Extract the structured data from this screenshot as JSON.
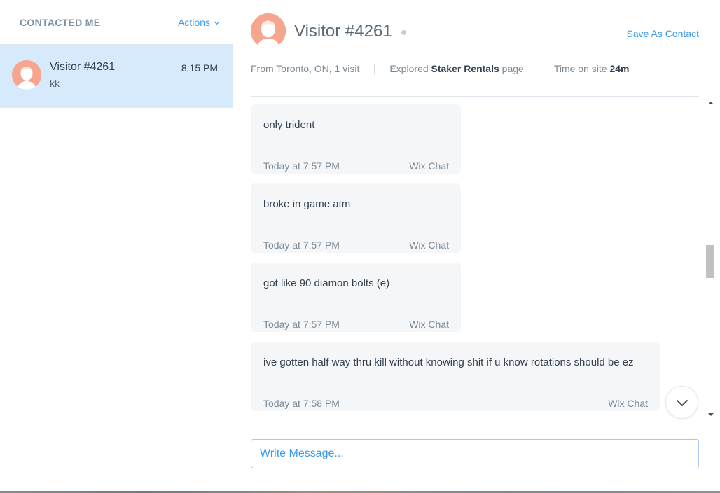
{
  "sidebar": {
    "title": "CONTACTED ME",
    "actions_label": "Actions",
    "conversations": [
      {
        "name": "Visitor #4261",
        "time": "8:15 PM",
        "preview": "kk"
      }
    ]
  },
  "header": {
    "visitor_name": "Visitor #4261",
    "save_contact_label": "Save As Contact",
    "location": "From Toronto, ON, 1 visit",
    "explored_prefix": "Explored",
    "explored_page": "Staker Rentals",
    "explored_suffix": "page",
    "time_on_site_label": "Time on site",
    "time_on_site_value": "24m"
  },
  "messages": [
    {
      "text": "only trident",
      "time": "Today at 7:57 PM",
      "source": "Wix Chat"
    },
    {
      "text": "broke in game atm",
      "time": "Today at 7:57 PM",
      "source": "Wix Chat"
    },
    {
      "text": "got like 90 diamon bolts (e)",
      "time": "Today at 7:57 PM",
      "source": "Wix Chat"
    },
    {
      "text": "ive gotten half way thru kill without knowing shit if u know rotations should be ez",
      "time": "Today at 7:58 PM",
      "source": "Wix Chat"
    }
  ],
  "compose": {
    "placeholder": "Write Message...",
    "value": ""
  },
  "icons": {
    "actions": "chevron-down-icon",
    "avatar": "user-avatar-icon",
    "scroll_down": "chevron-down-icon",
    "scroll_up_arrow": "triangle-up-icon",
    "scroll_down_arrow": "triangle-down-icon"
  },
  "colors": {
    "accent": "#3899ec",
    "selected_row": "#d6eafc",
    "avatar": "#f6a58e",
    "bubble": "#f5f6f8"
  }
}
